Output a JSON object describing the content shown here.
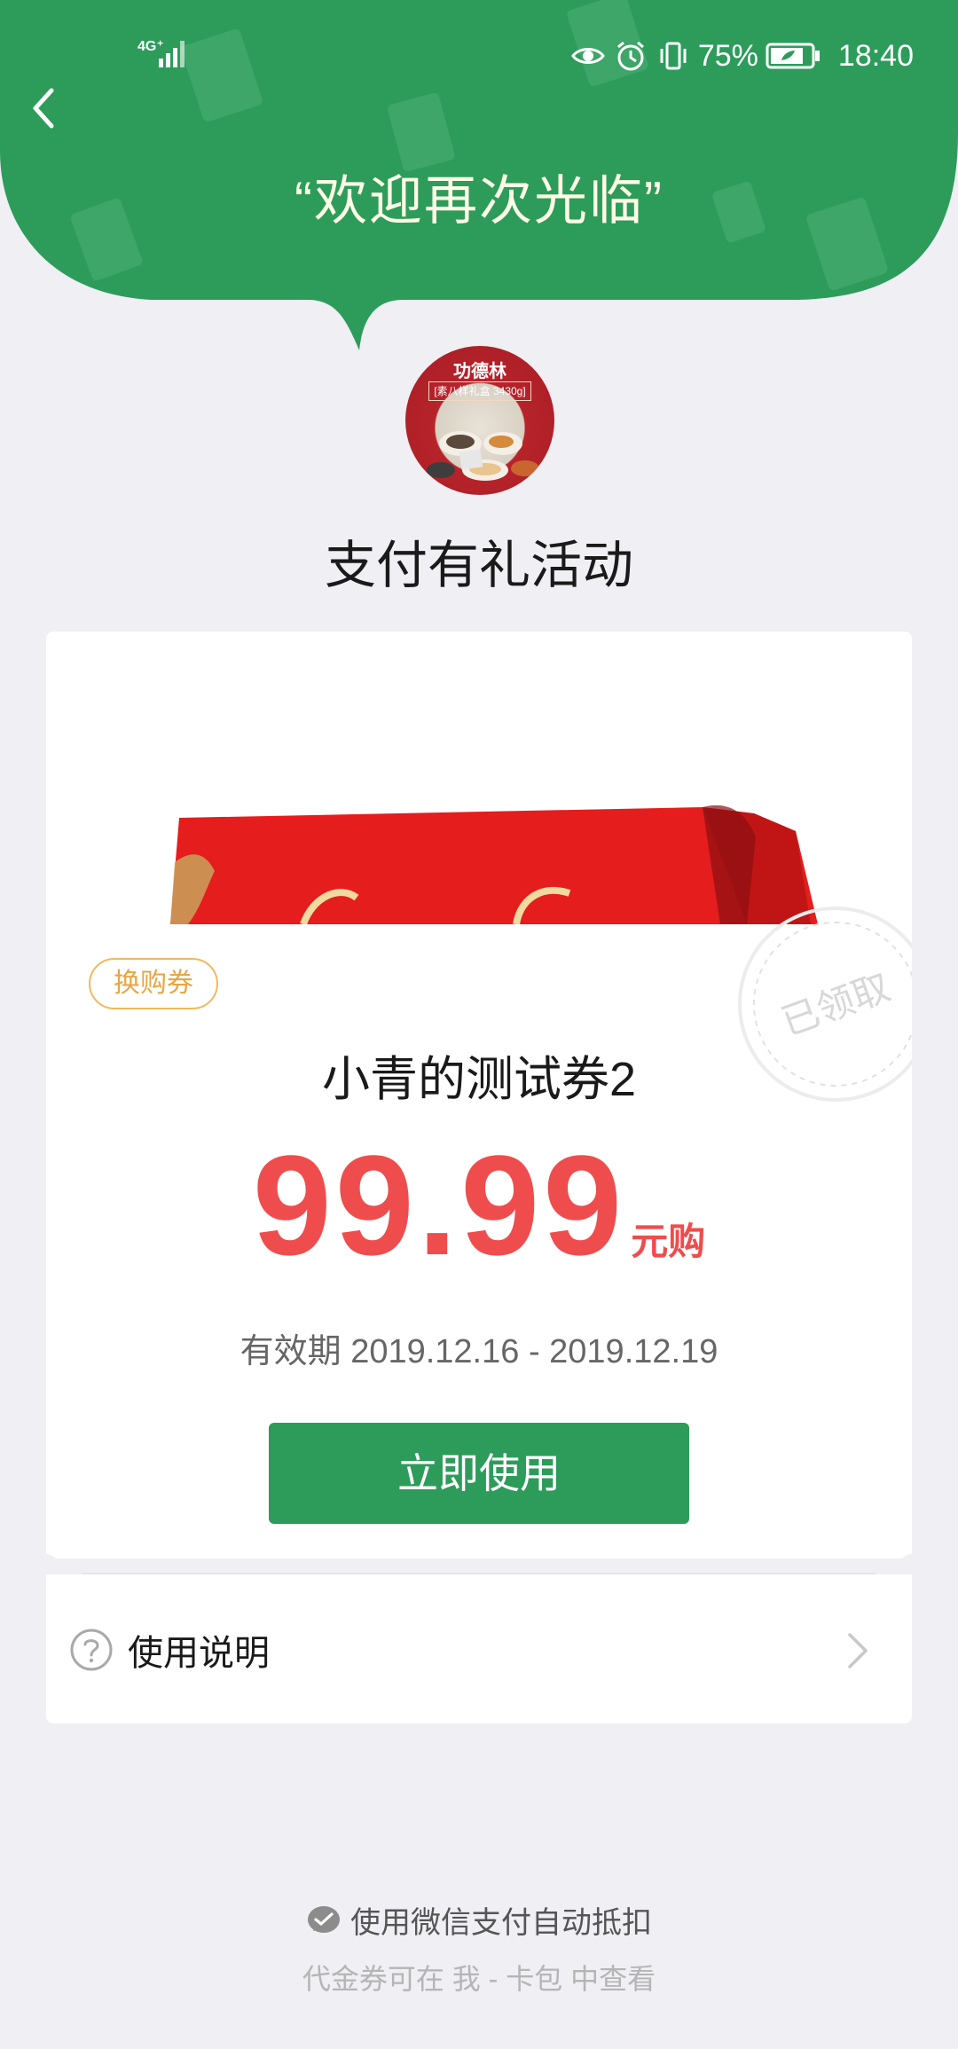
{
  "status_bar": {
    "network": "4G⁺",
    "battery": "75%",
    "time": "18:40"
  },
  "header": {
    "welcome": "“欢迎再次光临”",
    "bubble_color": "#2d9c5b"
  },
  "merchant": {
    "logo_brand": "功德林",
    "logo_tag": "[素八样礼盒 3430g]",
    "name": "支付有礼活动"
  },
  "coupon": {
    "type_badge": "换购券",
    "stamp_text": "已领取",
    "title": "小青的测试券2",
    "price": "99.99",
    "price_unit": "元购",
    "validity": "有效期 2019.12.16 - 2019.12.19",
    "use_button": "立即使用",
    "instructions": "使用说明",
    "accent_red": "#ef4d4d",
    "accent_green": "#2d9c5b",
    "badge_orange": "#f0b95e"
  },
  "footer": {
    "auto_deduct": "使用微信支付自动抵扣",
    "card_pack_hint": "代金券可在 我 - 卡包 中查看"
  }
}
